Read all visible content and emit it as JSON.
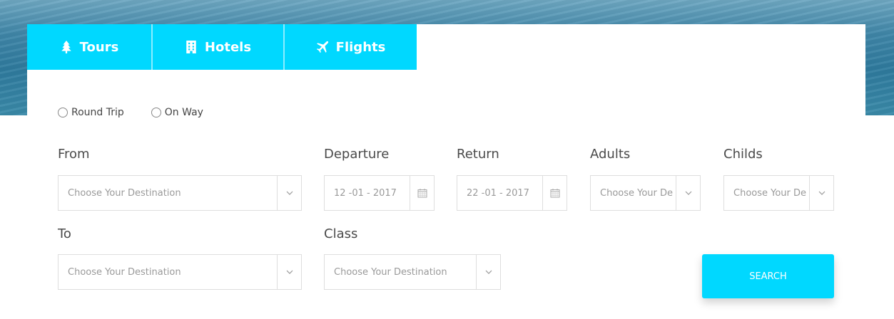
{
  "tabs": [
    {
      "label": "Tours",
      "icon": "tree-icon"
    },
    {
      "label": "Hotels",
      "icon": "building-icon"
    },
    {
      "label": "Flights",
      "icon": "plane-icon"
    }
  ],
  "trip_type": {
    "options": [
      "Round Trip",
      "On Way"
    ]
  },
  "form": {
    "from": {
      "label": "From",
      "placeholder": "Choose Your Destination"
    },
    "departure": {
      "label": "Departure",
      "value": "12 -01 - 2017"
    },
    "return": {
      "label": "Return",
      "value": "22 -01 - 2017"
    },
    "adults": {
      "label": "Adults",
      "placeholder": "Choose Your De"
    },
    "childs": {
      "label": "Childs",
      "placeholder": "Choose Your De"
    },
    "to": {
      "label": "To",
      "placeholder": "Choose Your Destination"
    },
    "class": {
      "label": "Class",
      "placeholder": "Choose Your Destination"
    }
  },
  "search_label": "SEARCH",
  "colors": {
    "accent": "#00d8ff",
    "text": "#4a4a4a",
    "placeholder": "#9a9a9a",
    "border": "#dedede"
  }
}
